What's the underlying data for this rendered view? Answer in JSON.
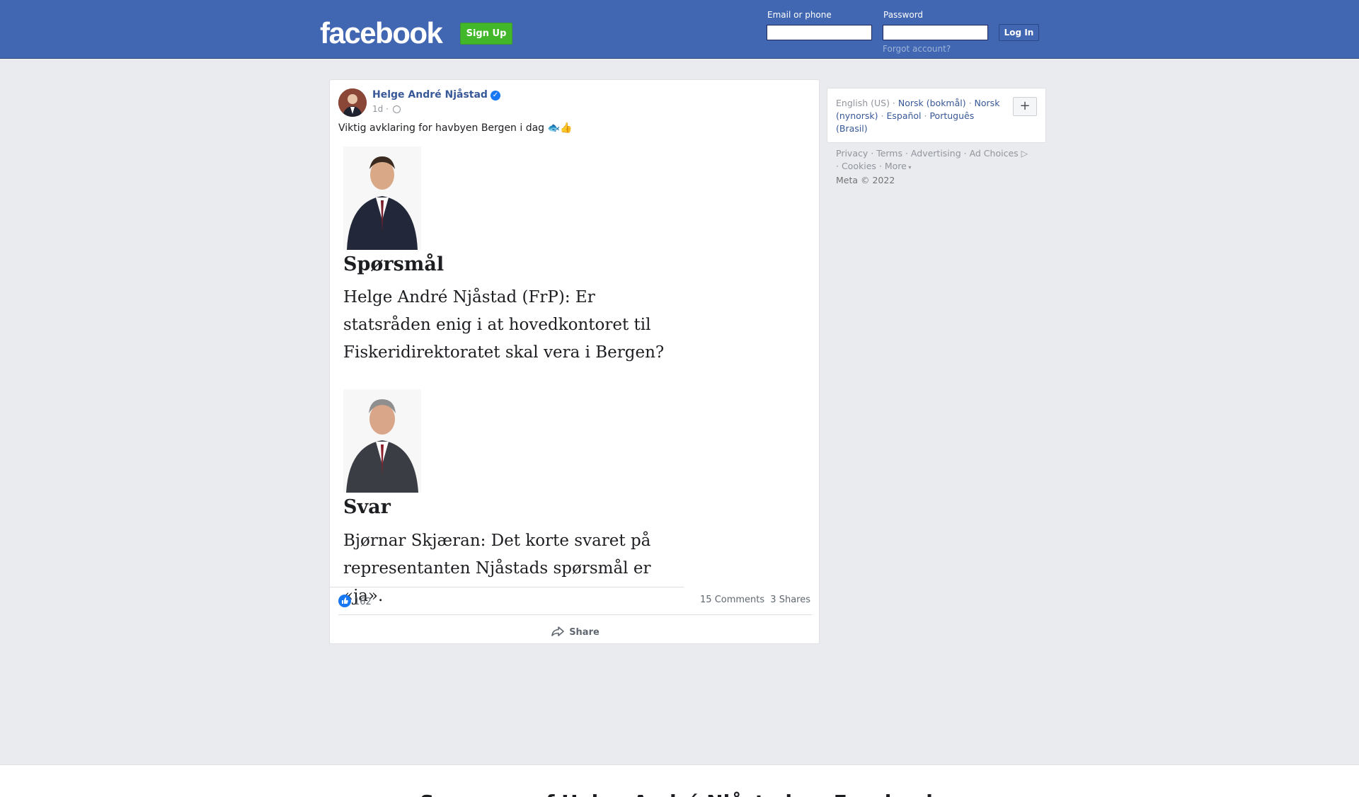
{
  "header": {
    "logo": "facebook",
    "signup_label": "Sign Up",
    "email_label": "Email or phone",
    "password_label": "Password",
    "login_label": "Log In",
    "forgot_label": "Forgot account?"
  },
  "post": {
    "author": "Helge André Njåstad",
    "time": "1d ·",
    "text": "Viktig avklaring for havbyen Bergen i dag 🐟👍",
    "card": {
      "question_heading": "Spørsmål",
      "question_text": "Helge André Njåstad (FrP): Er statsråden enig i at hovedkontoret til Fiskeridirektoratet skal vera i Bergen?",
      "answer_heading": "Svar",
      "answer_text": "Bjørnar Skjæran: Det korte svaret på representanten Njåstads spørsmål er «ja»."
    },
    "likes": "162",
    "comments": "15 Comments",
    "shares": "3 Shares",
    "share_label": "Share"
  },
  "sidebar": {
    "languages": [
      "English (US)",
      "Norsk (bokmål)",
      "Norsk (nynorsk)",
      "Español",
      "Português (Brasil)"
    ],
    "add_language": "+",
    "links": [
      "Privacy",
      "Terms",
      "Advertising",
      "Ad Choices",
      "Cookies",
      "More"
    ],
    "copyright": "Meta © 2022"
  },
  "footer": {
    "title": "See more of Helge André Njåstad on Facebook"
  },
  "colors": {
    "brand_blue": "#4267b2",
    "signup_green": "#42b72a",
    "link_blue": "#385898",
    "page_bg": "#e9ebee"
  }
}
